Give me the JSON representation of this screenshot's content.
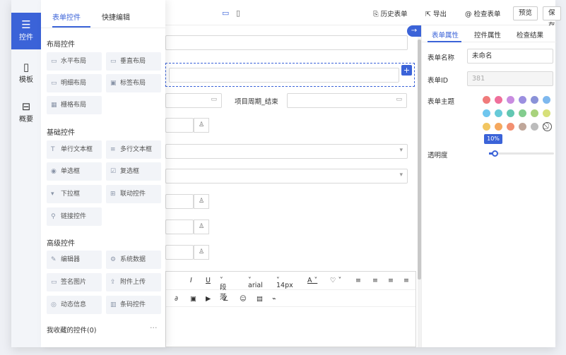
{
  "rail": {
    "items": [
      {
        "icon": "sliders-icon",
        "glyph": "☰",
        "label": "控件"
      },
      {
        "icon": "template-icon",
        "glyph": "▯",
        "label": "模板"
      },
      {
        "icon": "outline-icon",
        "glyph": "⊟",
        "label": "概要"
      }
    ]
  },
  "panel": {
    "tabs": [
      "表单控件",
      "快捷编辑"
    ],
    "sections": {
      "layout": "布局控件",
      "basic": "基础控件",
      "advanced": "高级控件"
    },
    "layout_controls": [
      "水平布局",
      "垂直布局",
      "明细布局",
      "标签布局",
      "栅格布局"
    ],
    "basic_controls": [
      "单行文本框",
      "多行文本框",
      "单选框",
      "复选框",
      "下拉框",
      "联动控件",
      "链接控件"
    ],
    "advanced_controls": [
      "编辑器",
      "系统数据",
      "签名图片",
      "附件上传",
      "动态信息",
      "条码控件"
    ],
    "favorites": "我收藏的控件(0)",
    "favorites_more": "···"
  },
  "topbar": {
    "history": "历史表单",
    "export": "导出",
    "check": "检查表单",
    "preview": "预览",
    "save": "保存"
  },
  "canvas": {
    "date_end_label": "项目周期_结束",
    "toolbar": {
      "paragraph": "段落",
      "font": "arial",
      "size": "14px"
    }
  },
  "rpanel": {
    "tabs": [
      "表单属性",
      "控件属性",
      "检查结果"
    ],
    "form_name_label": "表单名称",
    "form_name_value": "未命名",
    "form_id_label": "表单ID",
    "form_id_value": "381",
    "theme_label": "表单主题",
    "theme_colors": [
      "#f07b7b",
      "#ef6f9b",
      "#c98ce0",
      "#9b8fe0",
      "#8a92d8",
      "#7eb8ee",
      "#6fc6ee",
      "#67cad8",
      "#62c7b2",
      "#83cd8e",
      "#a8d27c",
      "#d7e07a",
      "#f2c661",
      "#f5a85e",
      "#f29071",
      "#c0a79a",
      "#bcbcbc"
    ],
    "opacity_label": "透明度",
    "opacity_value": "10%",
    "opacity_fraction": 0.1
  }
}
